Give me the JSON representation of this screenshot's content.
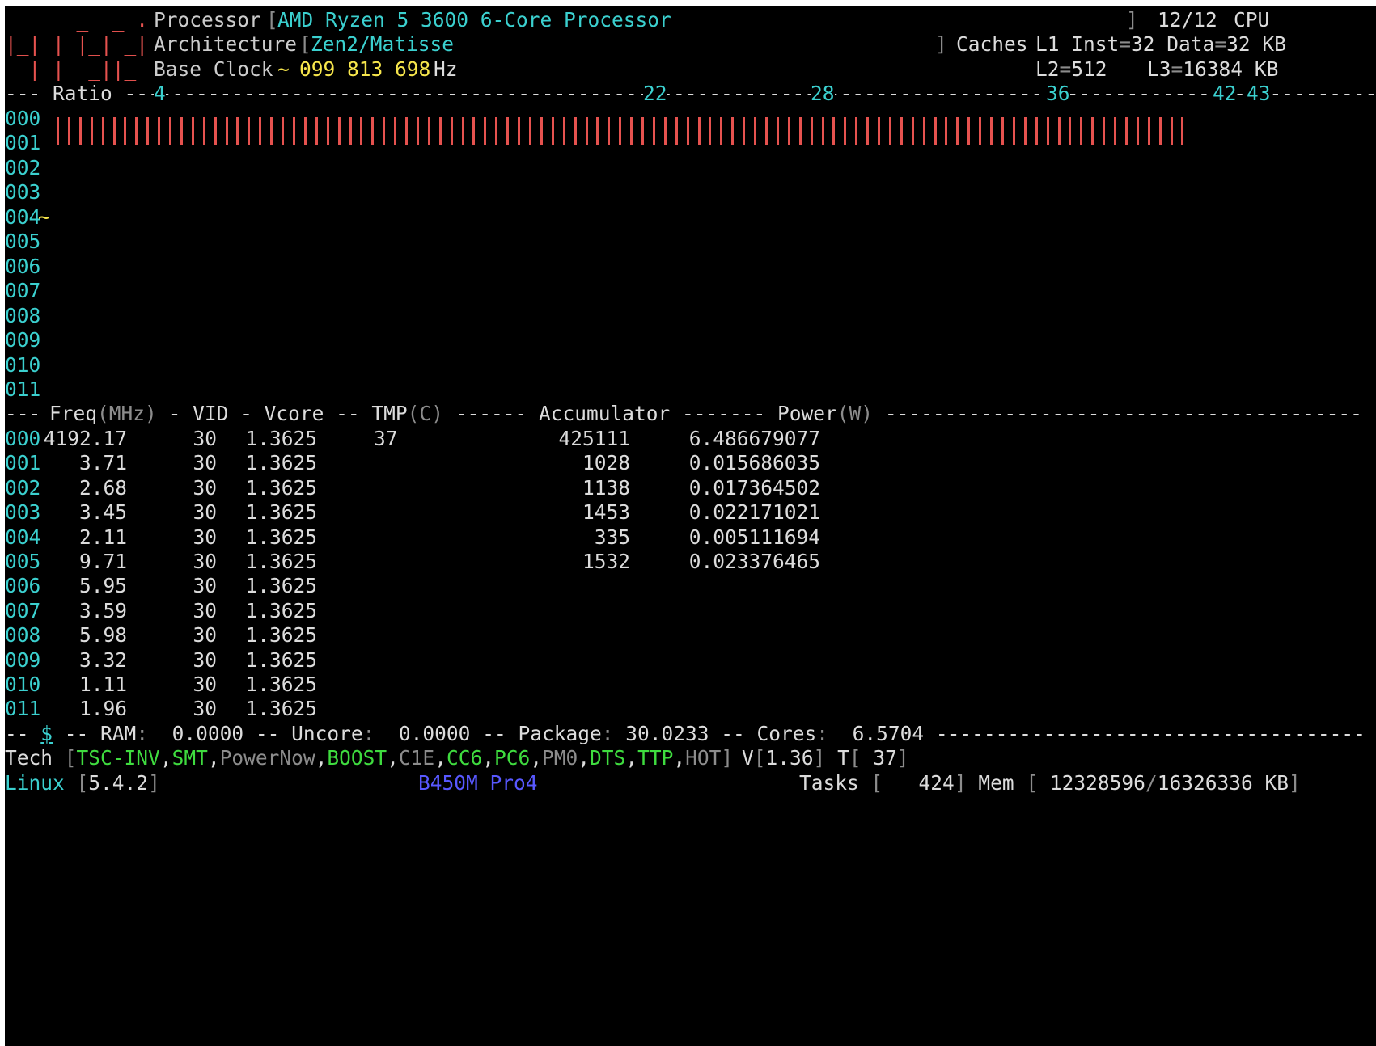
{
  "logo": {
    "line1": "      _  _ .",
    "line2": "|_| | |_| _|",
    "line3": "  | |  _||_"
  },
  "processor": {
    "label": "Processor",
    "name": "AMD Ryzen 5 3600 6-Core Processor",
    "cpu_count": "12/12",
    "cpu_label": "CPU"
  },
  "architecture": {
    "label": "Architecture",
    "value": "Zen2/Matisse"
  },
  "caches": {
    "label": "Caches",
    "l1_inst": "32",
    "l1_data": "32",
    "l2": "512",
    "l3": "16384",
    "unit": "KB"
  },
  "base_clock": {
    "label": "Base Clock",
    "value": "099 813 698",
    "unit": "Hz"
  },
  "ratio": {
    "label": "Ratio",
    "ticks": [
      "4",
      "22",
      "28",
      "36",
      "42",
      "43"
    ]
  },
  "cores": [
    "000",
    "001",
    "002",
    "003",
    "004",
    "005",
    "006",
    "007",
    "008",
    "009",
    "010",
    "011"
  ],
  "core_bar": {
    "core": "000",
    "fill_fraction": 0.96
  },
  "core_004_marker": "~",
  "table": {
    "headers": {
      "freq": "Freq",
      "freq_unit": "MHz",
      "vid": "VID",
      "vcore": "Vcore",
      "tmp": "TMP",
      "tmp_unit": "C",
      "acc": "Accumulator",
      "power": "Power",
      "power_unit": "W"
    },
    "rows": [
      {
        "core": "000",
        "freq": "4192.17",
        "vid": "30",
        "vcore": "1.3625",
        "tmp": "37",
        "acc": "425111",
        "power": "6.486679077"
      },
      {
        "core": "001",
        "freq": "3.71",
        "vid": "30",
        "vcore": "1.3625",
        "tmp": "",
        "acc": "1028",
        "power": "0.015686035"
      },
      {
        "core": "002",
        "freq": "2.68",
        "vid": "30",
        "vcore": "1.3625",
        "tmp": "",
        "acc": "1138",
        "power": "0.017364502"
      },
      {
        "core": "003",
        "freq": "3.45",
        "vid": "30",
        "vcore": "1.3625",
        "tmp": "",
        "acc": "1453",
        "power": "0.022171021"
      },
      {
        "core": "004",
        "freq": "2.11",
        "vid": "30",
        "vcore": "1.3625",
        "tmp": "",
        "acc": "335",
        "power": "0.005111694"
      },
      {
        "core": "005",
        "freq": "9.71",
        "vid": "30",
        "vcore": "1.3625",
        "tmp": "",
        "acc": "1532",
        "power": "0.023376465"
      },
      {
        "core": "006",
        "freq": "5.95",
        "vid": "30",
        "vcore": "1.3625",
        "tmp": "",
        "acc": "",
        "power": ""
      },
      {
        "core": "007",
        "freq": "3.59",
        "vid": "30",
        "vcore": "1.3625",
        "tmp": "",
        "acc": "",
        "power": ""
      },
      {
        "core": "008",
        "freq": "5.98",
        "vid": "30",
        "vcore": "1.3625",
        "tmp": "",
        "acc": "",
        "power": ""
      },
      {
        "core": "009",
        "freq": "3.32",
        "vid": "30",
        "vcore": "1.3625",
        "tmp": "",
        "acc": "",
        "power": ""
      },
      {
        "core": "010",
        "freq": "1.11",
        "vid": "30",
        "vcore": "1.3625",
        "tmp": "",
        "acc": "",
        "power": ""
      },
      {
        "core": "011",
        "freq": "1.96",
        "vid": "30",
        "vcore": "1.3625",
        "tmp": "",
        "acc": "",
        "power": ""
      }
    ]
  },
  "power_summary": {
    "dollar": "$",
    "ram_label": "RAM",
    "ram": "0.0000",
    "uncore_label": "Uncore",
    "uncore": "0.0000",
    "package_label": "Package",
    "package": "30.0233",
    "cores_label": "Cores",
    "cores": "6.5704"
  },
  "tech": {
    "label": "Tech",
    "flags": [
      {
        "name": "TSC-INV",
        "on": true
      },
      {
        "name": "SMT",
        "on": true
      },
      {
        "name": "PowerNow",
        "on": false
      },
      {
        "name": "BOOST",
        "on": true
      },
      {
        "name": "C1E",
        "on": false
      },
      {
        "name": "CC6",
        "on": true
      },
      {
        "name": "PC6",
        "on": true
      },
      {
        "name": "PM0",
        "on": false
      },
      {
        "name": "DTS",
        "on": true
      },
      {
        "name": "TTP",
        "on": true
      },
      {
        "name": "HOT",
        "on": false
      }
    ],
    "v_label": "V",
    "v": "1.36",
    "t_label": "T",
    "t": " 37"
  },
  "footer": {
    "os": "Linux",
    "kernel": "5.4.2",
    "board": "B450M Pro4",
    "tasks_label": "Tasks",
    "tasks": "   424",
    "mem_label": "Mem",
    "mem_used": "12328596",
    "mem_total": "16326336",
    "mem_unit": "KB"
  },
  "colors": {
    "cyan": "#3bd0cf",
    "yellow": "#f7e64c",
    "red": "#e6524f",
    "green": "#3fdc3f",
    "blue": "#5858ff",
    "dim": "#8c8c8c"
  }
}
